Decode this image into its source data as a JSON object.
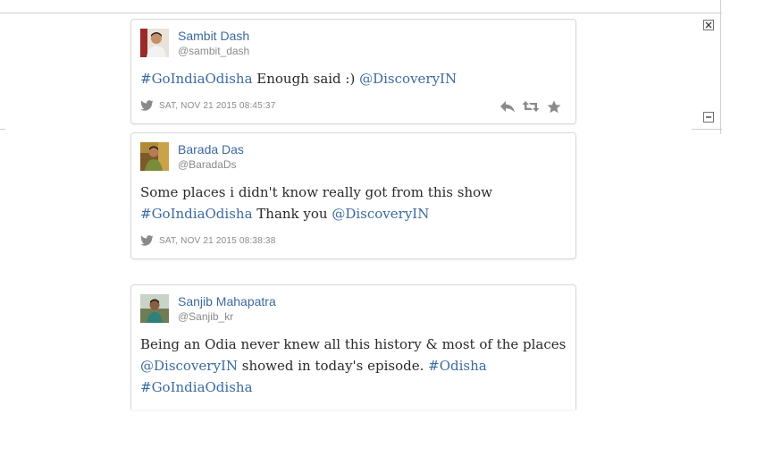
{
  "tweets": [
    {
      "name": "Sambit Dash",
      "handle": "@sambit_dash",
      "text": [
        {
          "t": "#GoIndiaOdisha",
          "k": "tag"
        },
        {
          "t": " Enough said :) ",
          "k": "plain"
        },
        {
          "t": "@DiscoveryIN",
          "k": "mention"
        }
      ],
      "timestamp": "SAT, NOV 21 2015 08:45:37"
    },
    {
      "name": "Barada Das",
      "handle": "@BaradaDs",
      "text": [
        {
          "t": "Some places i didn't know really got from this show ",
          "k": "plain"
        },
        {
          "t": "#GoIndiaOdisha",
          "k": "tag"
        },
        {
          "t": " Thank you ",
          "k": "plain"
        },
        {
          "t": "@DiscoveryIN",
          "k": "mention"
        }
      ],
      "timestamp": "SAT, NOV 21 2015 08:38:38"
    },
    {
      "name": "Sanjib Mahapatra",
      "handle": "@Sanjib_kr",
      "text": [
        {
          "t": "Being an Odia never knew all this history & most of the places ",
          "k": "plain"
        },
        {
          "t": "@DiscoveryIN",
          "k": "mention"
        },
        {
          "t": " showed in today's episode. ",
          "k": "plain"
        },
        {
          "t": "#Odisha",
          "k": "tag"
        },
        {
          "t": " ",
          "k": "plain"
        },
        {
          "t": "#GoIndiaOdisha",
          "k": "tag"
        }
      ]
    }
  ],
  "icons": {
    "window_close": "close-icon",
    "window_minimize": "minimize-icon",
    "twitter": "twitter-bird-icon",
    "reply": "reply-icon",
    "retweet": "retweet-icon",
    "favorite": "star-icon"
  },
  "colors": {
    "link": "#3b6aa0",
    "meta": "#8a8a8a",
    "icon": "#8a8a8a",
    "border": "#d8d8d8"
  }
}
